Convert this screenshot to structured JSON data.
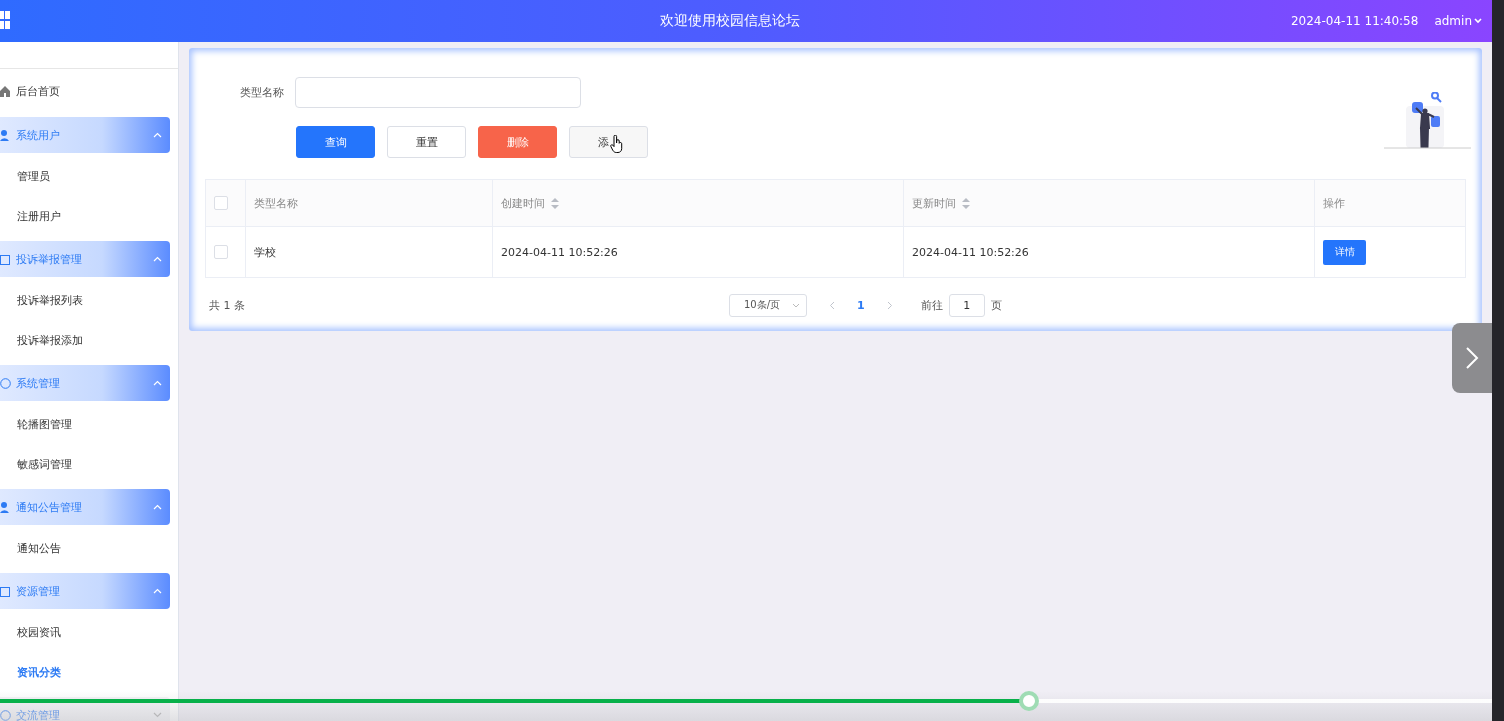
{
  "header": {
    "title": "欢迎使用校园信息论坛",
    "datetime": "2024-04-11 11:40:58",
    "user": "admin"
  },
  "sidebar": {
    "items": [
      {
        "kind": "link",
        "label": "后台首页",
        "selected": false
      },
      {
        "kind": "group",
        "label": "系统用户",
        "expanded": true,
        "children": [
          {
            "label": "管理员",
            "selected": false
          },
          {
            "label": "注册用户",
            "selected": false
          }
        ]
      },
      {
        "kind": "group",
        "label": "投诉举报管理",
        "expanded": true,
        "children": [
          {
            "label": "投诉举报列表",
            "selected": false
          },
          {
            "label": "投诉举报添加",
            "selected": false
          }
        ]
      },
      {
        "kind": "group",
        "label": "系统管理",
        "expanded": true,
        "children": [
          {
            "label": "轮播图管理",
            "selected": false
          },
          {
            "label": "敏感词管理",
            "selected": false
          }
        ]
      },
      {
        "kind": "group",
        "label": "通知公告管理",
        "expanded": true,
        "children": [
          {
            "label": "通知公告",
            "selected": false
          }
        ]
      },
      {
        "kind": "group",
        "label": "资源管理",
        "expanded": true,
        "children": [
          {
            "label": "校园资讯",
            "selected": false
          },
          {
            "label": "资讯分类",
            "selected": true
          }
        ]
      },
      {
        "kind": "group",
        "label": "交流管理",
        "expanded": false
      }
    ]
  },
  "search": {
    "label": "类型名称"
  },
  "buttons": [
    {
      "label": "查询",
      "kind": "primary"
    },
    {
      "label": "重置",
      "kind": "default"
    },
    {
      "label": "删除",
      "kind": "danger"
    },
    {
      "label": "添",
      "kind": "plain"
    }
  ],
  "table": {
    "all_checked": false,
    "columns": [
      {
        "label": "类型名称",
        "sortable": false
      },
      {
        "label": "创建时间",
        "sortable": true
      },
      {
        "label": "更新时间",
        "sortable": true
      },
      {
        "label": "操作",
        "sortable": false
      }
    ],
    "rows": [
      {
        "checked": false,
        "cells": [
          "学校",
          "2024-04-11 10:52:26",
          "2024-04-11 10:52:26"
        ],
        "action": "详情"
      }
    ]
  },
  "pagination": {
    "total": "共 1 条",
    "page_size": "10条/页",
    "pages": [
      {
        "label": "1",
        "selected": true
      }
    ],
    "goto_label": "前往",
    "goto_value": "1",
    "unit": "页"
  },
  "player": {
    "level": 0.69
  }
}
